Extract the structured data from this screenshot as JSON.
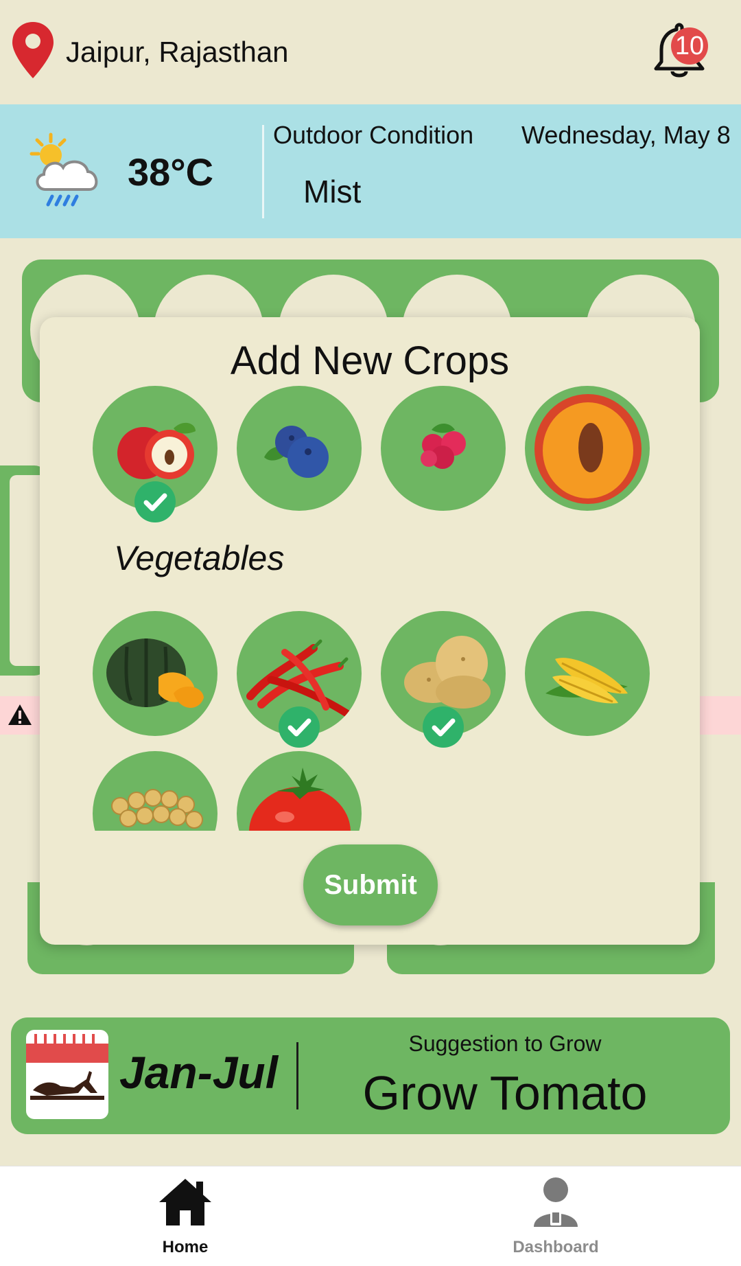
{
  "header": {
    "location": "Jaipur, Rajasthan",
    "notification_count": "10"
  },
  "weather": {
    "temperature": "38°C",
    "outdoor_label": "Outdoor Condition",
    "condition": "Mist",
    "date": "Wednesday, May 8"
  },
  "modal": {
    "title": "Add New Crops",
    "fruits": [
      {
        "icon": "apple-icon",
        "selected": true
      },
      {
        "icon": "blueberry-icon",
        "selected": false
      },
      {
        "icon": "raspberry-icon",
        "selected": false
      },
      {
        "icon": "peach-icon",
        "selected": false
      }
    ],
    "vegetables_title": "Vegetables",
    "vegetables": [
      {
        "icon": "pumpkin-icon",
        "selected": false
      },
      {
        "icon": "chili-icon",
        "selected": true
      },
      {
        "icon": "potato-icon",
        "selected": true
      },
      {
        "icon": "corn-icon",
        "selected": false
      },
      {
        "icon": "soybean-icon",
        "selected": false
      },
      {
        "icon": "tomato-icon",
        "selected": false
      }
    ],
    "submit_label": "Submit"
  },
  "suggestion": {
    "season": "Jan-Jul",
    "label": "Suggestion to Grow",
    "value": "Grow Tomato"
  },
  "nav": {
    "home_label": "Home",
    "dashboard_label": "Dashboard"
  },
  "colors": {
    "accent_green": "#6eb662",
    "background": "#ece8d0",
    "weather_band": "#abe0e5",
    "check_green": "#2fb26a",
    "badge_red": "#e24a4a"
  }
}
